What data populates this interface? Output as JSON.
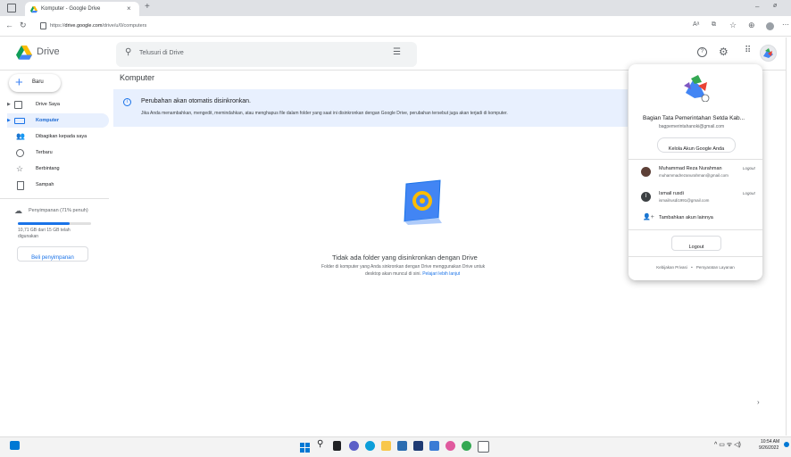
{
  "browser": {
    "tab_title": "Komputer - Google Drive",
    "tab_close": "×",
    "new_tab": "+",
    "url": "https://drive.google.com/drive/u/0/computers",
    "url_host": "drive.google.com",
    "url_prefix": "https://",
    "url_suffix": "/drive/u/0/computers",
    "window_minimize": "–",
    "window_restore": "ø"
  },
  "header": {
    "product_name": "Drive",
    "search_placeholder": "Telusuri di Drive"
  },
  "sidebar": {
    "new_button": "Baru",
    "items": [
      {
        "label": "Drive Saya",
        "icon": "drive-icon"
      },
      {
        "label": "Komputer",
        "icon": "computer-icon",
        "active": true
      },
      {
        "label": "Dibagikan kepada saya",
        "icon": "shared-icon"
      },
      {
        "label": "Terbaru",
        "icon": "clock-icon"
      },
      {
        "label": "Berbintang",
        "icon": "star-icon"
      },
      {
        "label": "Sampah",
        "icon": "trash-icon"
      }
    ],
    "storage_label": "Penyimpanan (71% penuh)",
    "storage_used_fraction": 0.71,
    "storage_text": "10,71 GB dari 15 GB telah digunakan",
    "buy_storage": "Beli penyimpanan"
  },
  "main": {
    "title": "Komputer",
    "banner_title": "Perubahan akan otomatis disinkronkan.",
    "banner_body": "Jika Anda menambahkan, mengedit, memindahkan, atau menghapus file dalam folder yang saat ini disinkronkan dengan Google Drive, perubahan tersebut juga akan terjadi di komputer.",
    "empty_title": "Tidak ada folder yang disinkronkan dengan Drive",
    "empty_body_line1": "Folder di komputer yang Anda sinkronkan dengan Drive menggunakan Drive untuk",
    "empty_body_line2": "desktop akan muncul di sini.",
    "learn_more": "Pelajari lebih lanjut"
  },
  "account": {
    "name": "Bagian Tata Pemerintahan Setda Kab...",
    "email": "bagpemerintahanoki@gmail.com",
    "manage_button": "Kelola Akun Google Anda",
    "others": [
      {
        "name": "Muhammad Reza Nurahman",
        "email": "muhammadrezanurahman@gmail.com",
        "action": "Logout"
      },
      {
        "name": "Ismail rusdi",
        "email": "ismailrusdi1991@gmail.com",
        "action": "Logout"
      }
    ],
    "add_account": "Tambahkan akun lainnya",
    "logout_button": "Logout",
    "privacy": "Kebijakan Privasi",
    "separator": "•",
    "terms": "Persyaratan Layanan"
  },
  "taskbar": {
    "time": "10:54 AM",
    "date": "9/26/2022"
  },
  "colors": {
    "accent_blue": "#1a73e8",
    "banner_bg": "#e8f0fe",
    "active_nav": "#e8f0fe"
  }
}
